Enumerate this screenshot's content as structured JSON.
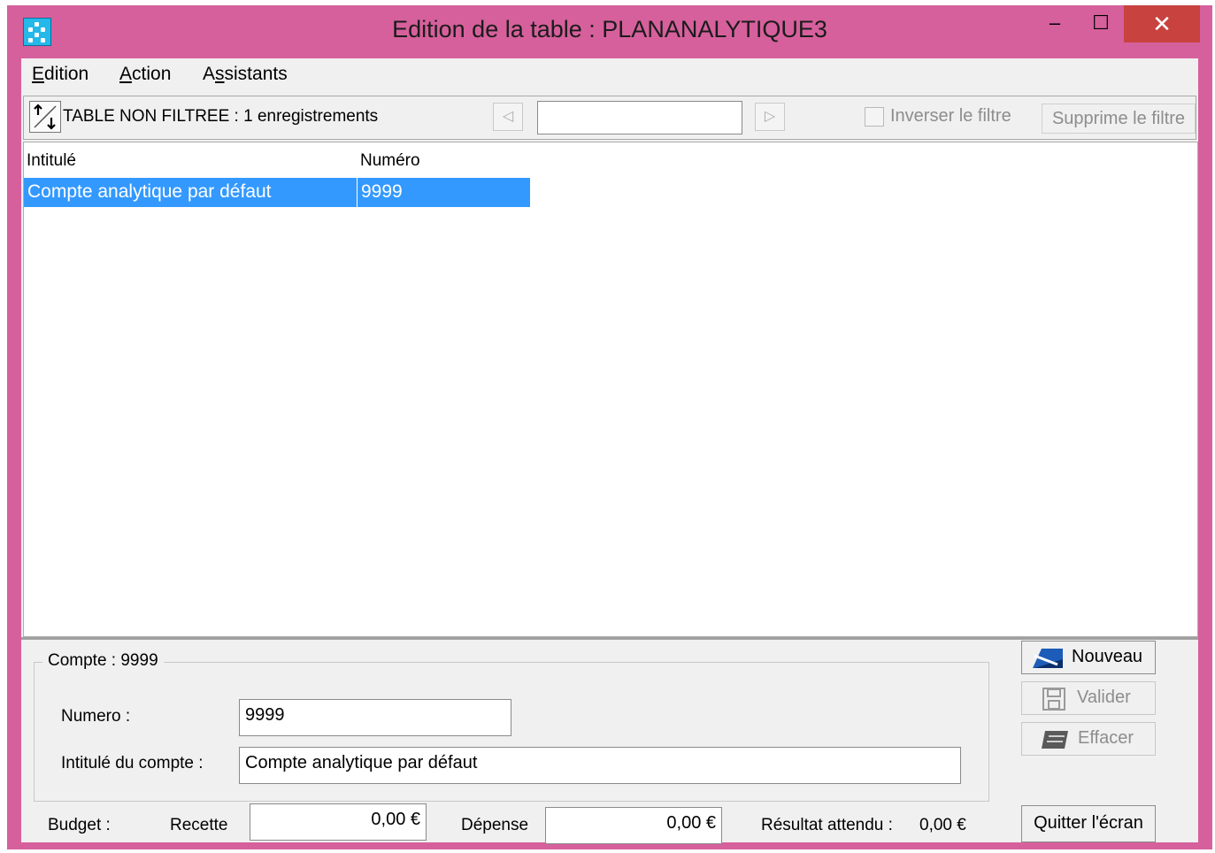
{
  "window": {
    "title": "Edition de la table : PLANANALYTIQUE3",
    "minimize_glyph": "–",
    "maximize_glyph": "☐",
    "close_glyph": "✕",
    "accent_color": "#d6609c"
  },
  "menu": {
    "items": [
      {
        "label": "Edition",
        "accel": "E",
        "rest": "dition"
      },
      {
        "label": "Action",
        "accel": "A",
        "rest": "ction"
      },
      {
        "label": "Assistants",
        "pre": "A",
        "accel": "s",
        "rest": "sistants"
      }
    ]
  },
  "toolbar": {
    "status": "TABLE NON FILTREE : 1 enregistrements",
    "prev_glyph": "◁",
    "next_glyph": "▷",
    "filter_value": "",
    "invert_label": "Inverser le filtre",
    "invert_checked": false,
    "remove_filter_label": "Supprime le filtre"
  },
  "table": {
    "columns": [
      "Intitulé",
      "Numéro"
    ],
    "rows": [
      {
        "intitule": "Compte analytique par défaut",
        "numero": "9999",
        "selected": true
      }
    ],
    "selection_color": "#3399ff"
  },
  "form": {
    "group_title": "Compte : 9999",
    "numero_label": "Numero :",
    "numero_value": "9999",
    "intitule_label": "Intitulé du compte :",
    "intitule_value": "Compte analytique par défaut"
  },
  "budget": {
    "label": "Budget :",
    "recette_label": "Recette",
    "recette_value": "0,00 €",
    "depense_label": "Dépense",
    "depense_value": "0,00 €",
    "resultat_label": "Résultat attendu :",
    "resultat_value": "0,00 €"
  },
  "actions": {
    "nouveau": "Nouveau",
    "valider": "Valider",
    "effacer": "Effacer",
    "quitter": "Quitter l'écran"
  }
}
